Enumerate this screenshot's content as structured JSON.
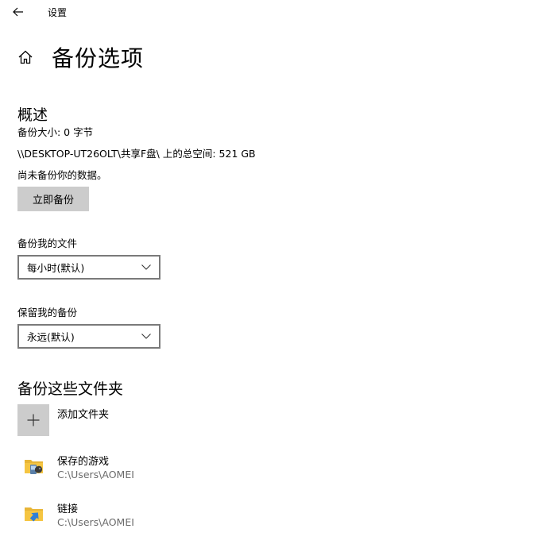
{
  "titlebar": {
    "back_icon": "arrow-left-icon",
    "title": "设置"
  },
  "page": {
    "home_icon": "home-icon",
    "title": "备份选项"
  },
  "overview": {
    "heading": "概述",
    "size_line": "备份大小: 0 字节",
    "space_line": "\\\\DESKTOP-UT26OLT\\共享F盘\\ 上的总空间: 521 GB",
    "status_line": "尚未备份你的数据。",
    "backup_now_label": "立即备份"
  },
  "frequency": {
    "label": "备份我的文件",
    "selected": "每小时(默认)"
  },
  "retention": {
    "label": "保留我的备份",
    "selected": "永远(默认)"
  },
  "folders": {
    "heading": "备份这些文件夹",
    "add_label": "添加文件夹",
    "items": [
      {
        "name": "保存的游戏",
        "path": "C:\\Users\\AOMEI",
        "icon": "saved-games-folder-icon"
      },
      {
        "name": "链接",
        "path": "C:\\Users\\AOMEI",
        "icon": "links-folder-icon"
      }
    ]
  },
  "colors": {
    "button_bg": "#cccccc",
    "dropdown_border": "#7a7a7a",
    "folder_yellow": "#f5c542",
    "link_arrow": "#2f7fd6",
    "secondary_text": "#6b6b6b"
  }
}
